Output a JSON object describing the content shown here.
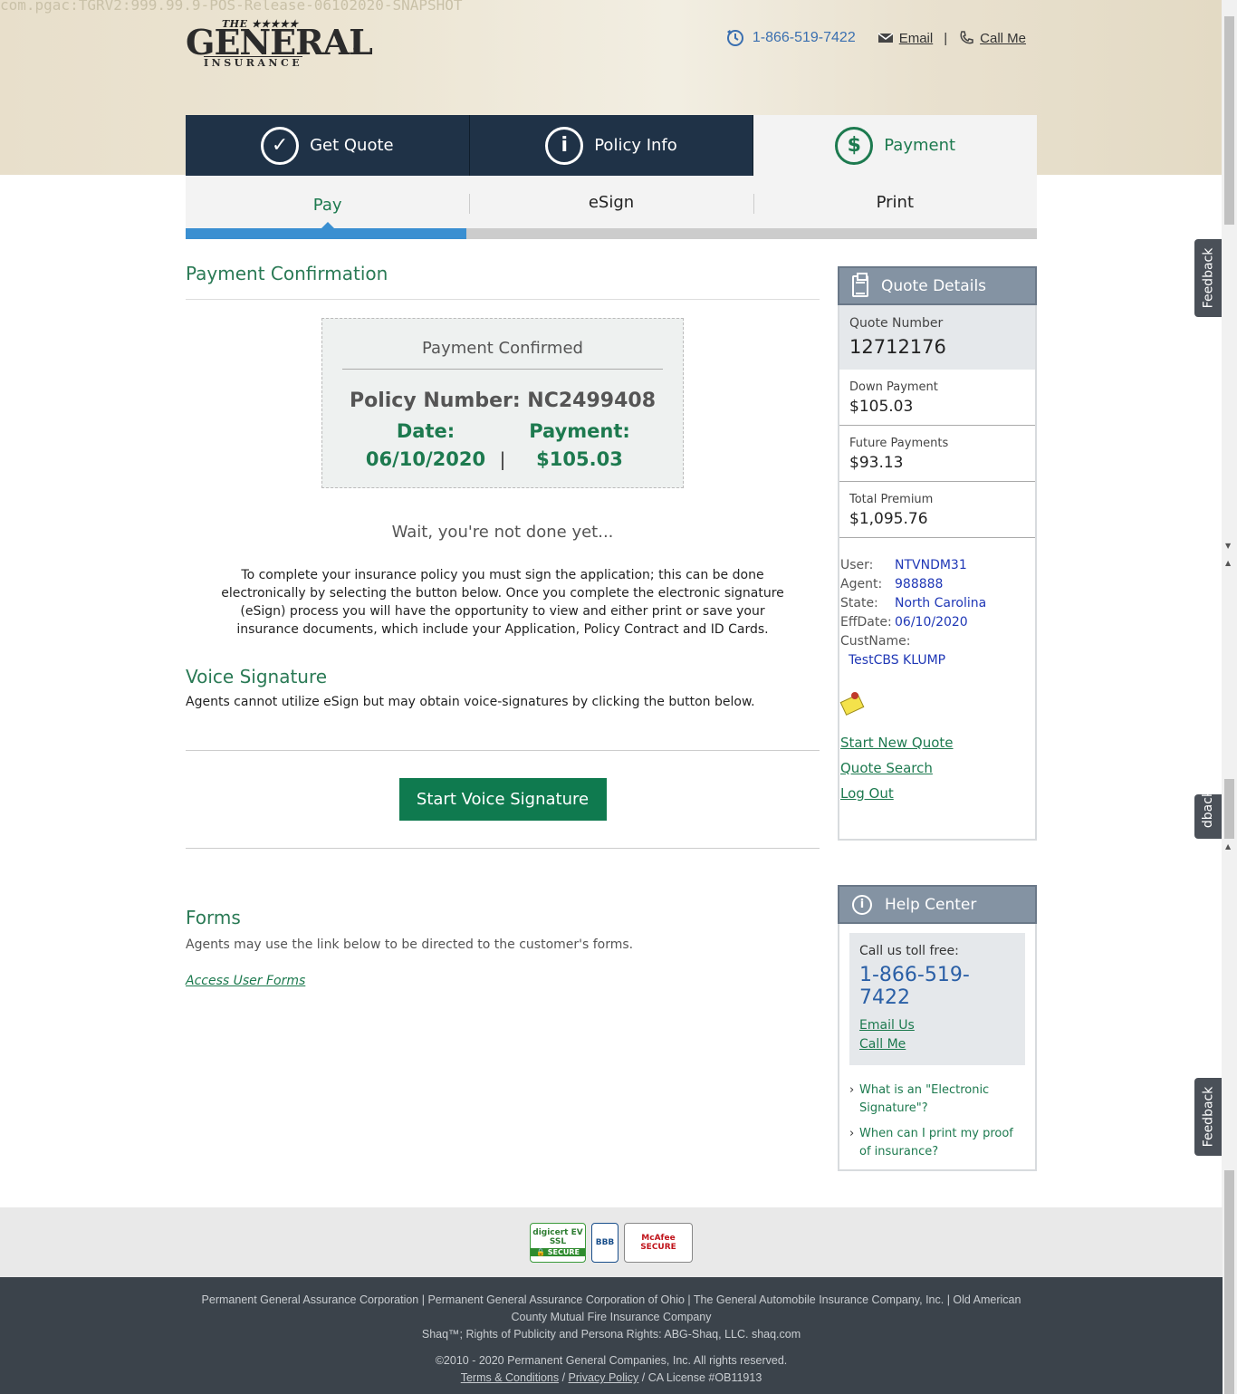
{
  "debug_build": "com.pgac:TGRV2:999.99.9-POS-Release-06102020-SNAPSHOT",
  "logo": {
    "the": "THE ★★★★★",
    "general": "GENERAL",
    "reg": "®",
    "insurance": "INSURANCE"
  },
  "top_bar": {
    "phone": "1-866-519-7422",
    "email": "Email",
    "call_me": "Call Me",
    "separator": "|"
  },
  "steps": [
    {
      "label": "Get Quote",
      "icon": "check-circle-icon",
      "glyph": "✓"
    },
    {
      "label": "Policy Info",
      "icon": "info-circle-icon",
      "glyph": "i"
    },
    {
      "label": "Payment",
      "icon": "dollar-circle-icon",
      "glyph": "$"
    }
  ],
  "substeps": [
    "Pay",
    "eSign",
    "Print"
  ],
  "progress_fraction": 0.33,
  "main": {
    "title": "Payment Confirmation",
    "confirm": {
      "title": "Payment Confirmed",
      "policy": "Policy Number: NC2499408",
      "date_label": "Date:",
      "payment_label": "Payment:",
      "date": "06/10/2020",
      "pipe": "|",
      "payment": "$105.03"
    },
    "wait": "Wait, you're not done yet...",
    "instructions": "To complete your insurance policy you must sign the application; this can be done electronically by selecting the button below. Once you complete the electronic signature (eSign) process you will have the opportunity to view and either print or save your insurance documents, which include your Application, Policy Contract and ID Cards.",
    "voice_title": "Voice Signature",
    "voice_text": "Agents cannot utilize eSign but may obtain voice-signatures by clicking the button below.",
    "voice_button": "Start Voice Signature",
    "forms_title": "Forms",
    "forms_text": "Agents may use the link below to be directed to the customer's forms.",
    "forms_link": "Access User Forms"
  },
  "quote_details": {
    "title": "Quote Details",
    "quote_number_label": "Quote Number",
    "quote_number": "12712176",
    "down_payment_label": "Down Payment",
    "down_payment": "$105.03",
    "future_payments_label": "Future Payments",
    "future_payments": "$93.13",
    "total_premium_label": "Total Premium",
    "total_premium": "$1,095.76",
    "user_label": "User:",
    "user": "NTVNDM31",
    "agent_label": "Agent:",
    "agent": "988888",
    "state_label": "State:",
    "state": "North Carolina",
    "effdate_label": "EffDate:",
    "effdate": "06/10/2020",
    "custname_label": "CustName:",
    "custname": "TestCBS KLUMP",
    "links": [
      "Start New Quote",
      "Quote Search",
      "Log Out"
    ]
  },
  "help_center": {
    "title": "Help Center",
    "call_label": "Call us toll free:",
    "phone": "1-866-519-7422",
    "email_us": "Email Us",
    "call_me": "Call Me",
    "faq": [
      "What is an \"Electronic Signature\"?",
      "When can I print my proof of insurance?"
    ]
  },
  "feedback_label": "Feedback",
  "feedback_partial": "dback",
  "seals": {
    "digicert": "digicert EV SSL",
    "digicert_bar": "🔒 SECURE",
    "bbb": "BBB",
    "mcafee": "McAfee SECURE"
  },
  "footer": {
    "companies": "Permanent General Assurance Corporation | Permanent General Assurance Corporation of Ohio | The General Automobile Insurance Company, Inc. | Old American County Mutual Fire Insurance Company",
    "shaq": "Shaq™; Rights of Publicity and Persona Rights: ABG-Shaq, LLC. shaq.com",
    "copyright": "©2010 - 2020 Permanent General Companies, Inc. All rights reserved.",
    "terms": "Terms & Conditions",
    "slash1": " / ",
    "privacy": "Privacy Policy",
    "license": " / CA License #OB11913"
  }
}
